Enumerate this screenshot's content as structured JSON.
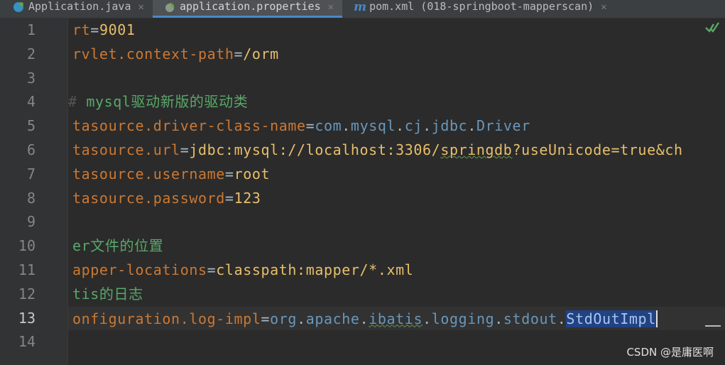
{
  "tabs": [
    {
      "label": "Application.java",
      "icon": "spring-class-icon",
      "active": false
    },
    {
      "label": "application.properties",
      "icon": "spring-properties-icon",
      "active": true
    },
    {
      "label": "pom.xml (018-springboot-mapperscan)",
      "icon": "maven-icon",
      "active": false
    }
  ],
  "line_numbers": [
    "1",
    "2",
    "3",
    "4",
    "5",
    "6",
    "7",
    "8",
    "9",
    "10",
    "11",
    "12",
    "13",
    "14"
  ],
  "current_line": "13",
  "code": {
    "l1_key": "rt",
    "l1_eq": "=",
    "l1_val": "9001",
    "l2_key": "rvlet.context-path",
    "l2_eq": "=",
    "l2_val": "/orm",
    "l4_hash": "#",
    "l4_comment": "mysql驱动新版的驱动类",
    "l5_key": "tasource.driver-class-name",
    "l5_eq": "=",
    "l5_val_a": "com",
    "l5_dot1": ".",
    "l5_val_b": "mysql",
    "l5_dot2": ".",
    "l5_val_c": "cj",
    "l5_dot3": ".",
    "l5_val_d": "jdbc",
    "l5_dot4": ".",
    "l5_val_e": "Driver",
    "l6_key": "tasource.url",
    "l6_eq": "=",
    "l6_val_a": "jdbc:mysql://localhost:3306/",
    "l6_val_b": "springdb",
    "l6_val_c": "?useUnicode=true&ch",
    "l7_key": "tasource.username",
    "l7_eq": "=",
    "l7_val": "root",
    "l8_key": "tasource.password",
    "l8_eq": "=",
    "l8_val": "123",
    "l10_comment": "er文件的位置",
    "l11_key": "apper-locations",
    "l11_eq": "=",
    "l11_val": "classpath:mapper/*.xml",
    "l12_comment": "tis的日志",
    "l13_key": "onfiguration.log-impl",
    "l13_eq": "=",
    "l13_val_a": "org",
    "l13_d1": ".",
    "l13_val_b": "apache",
    "l13_d2": ".",
    "l13_val_c": "ibatis",
    "l13_d3": ".",
    "l13_val_d": "logging",
    "l13_d4": ".",
    "l13_val_e": "stdout",
    "l13_d5": ".",
    "l13_sel": "StdOutImpl"
  },
  "watermark": "CSDN @是庸医啊",
  "colors": {
    "background": "#2b2b2b",
    "gutter": "#313335",
    "key": "#cc7832",
    "value": "#e8bf6a",
    "comment": "#629755",
    "selection": "#214283",
    "active_tab_underline": "#4a88c7"
  }
}
